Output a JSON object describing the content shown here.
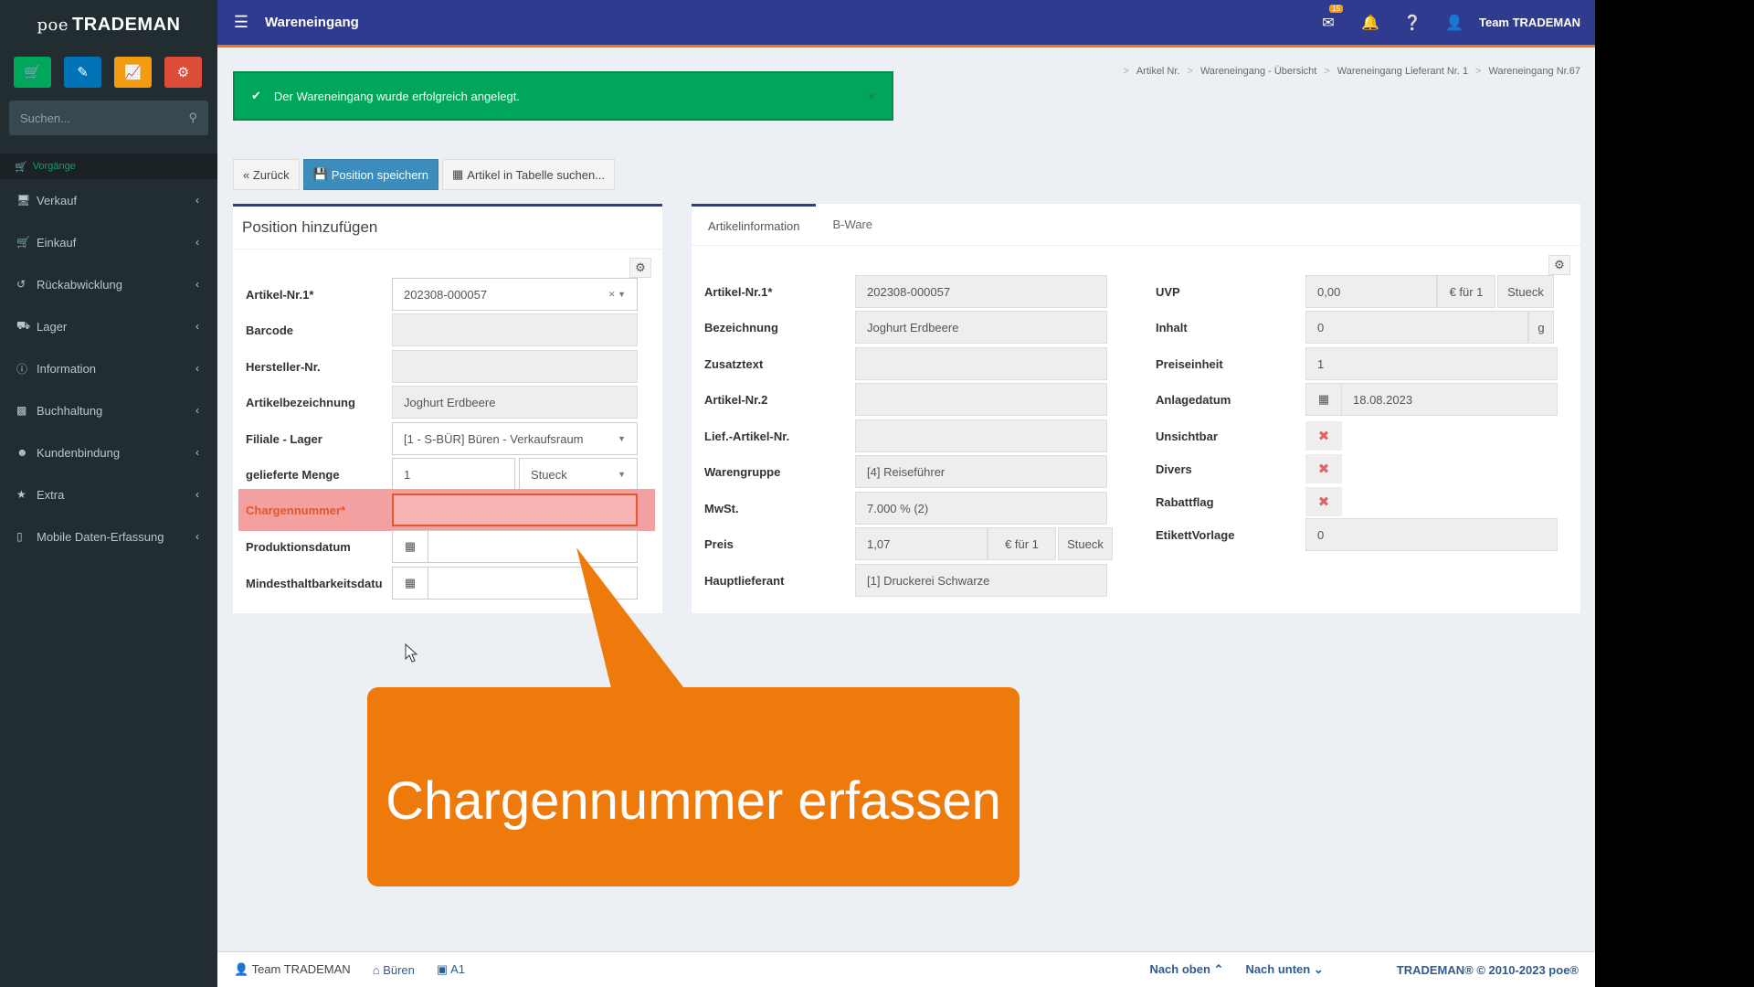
{
  "brand": {
    "poe": "poe",
    "name": "TRADEMAN"
  },
  "header": {
    "title": "Wareneingang",
    "user": "Team TRADEMAN",
    "mail_badge": "15"
  },
  "sidebar": {
    "search_placeholder": "Suchen...",
    "section": "Vorgänge",
    "items": [
      {
        "label": "Verkauf",
        "icon": "monitor-icon"
      },
      {
        "label": "Einkauf",
        "icon": "cart-icon"
      },
      {
        "label": "Rückabwicklung",
        "icon": "undo-icon"
      },
      {
        "label": "Lager",
        "icon": "truck-icon"
      },
      {
        "label": "Information",
        "icon": "info-icon"
      },
      {
        "label": "Buchhaltung",
        "icon": "money-icon"
      },
      {
        "label": "Kundenbindung",
        "icon": "users-icon"
      },
      {
        "label": "Extra",
        "icon": "star-icon"
      },
      {
        "label": "Mobile Daten-Erfassung",
        "icon": "mobile-icon"
      }
    ],
    "quick_colors": [
      "#00a65a",
      "#0073b7",
      "#f39c12",
      "#dd4b39"
    ]
  },
  "alert": {
    "text": "Der Wareneingang wurde erfolgreich angelegt."
  },
  "breadcrumb": [
    "Artikel Nr.",
    "Wareneingang - Übersicht",
    "Wareneingang Lieferant Nr. 1",
    "Wareneingang Nr.67"
  ],
  "toolbar": {
    "back": "« Zurück",
    "save": "Position speichern",
    "search": "Artikel in Tabelle suchen..."
  },
  "left_form": {
    "title": "Position hinzufügen",
    "artikel_nr_label": "Artikel-Nr.1*",
    "artikel_nr": "202308-000057",
    "barcode_label": "Barcode",
    "hersteller_label": "Hersteller-Nr.",
    "bezeichnung_label": "Artikelbezeichnung",
    "bezeichnung": "Joghurt Erdbeere",
    "filiale_label": "Filiale - Lager",
    "filiale": "[1 - S-BÜR] Büren - Verkaufsraum",
    "menge_label": "gelieferte Menge",
    "menge": "1",
    "einheit": "Stueck",
    "charge_label": "Chargennummer*",
    "prod_label": "Produktionsdatum",
    "mhd_label": "Mindesthaltbarkeitsdatu"
  },
  "right_panel": {
    "tabs": [
      "Artikelinformation",
      "B-Ware"
    ],
    "artikel_nr_label": "Artikel-Nr.1*",
    "artikel_nr": "202308-000057",
    "bezeichnung_label": "Bezeichnung",
    "bezeichnung": "Joghurt Erdbeere",
    "zusatz_label": "Zusatztext",
    "nr2_label": "Artikel-Nr.2",
    "lief_label": "Lief.-Artikel-Nr.",
    "warengruppe_label": "Warengruppe",
    "warengruppe": "[4] Reiseführer",
    "mwst_label": "MwSt.",
    "mwst": "7.000 % (2)",
    "preis_label": "Preis",
    "preis": "1,07",
    "preis_per": "€ für 1",
    "preis_unit": "Stueck",
    "hauptlief_label": "Hauptlieferant",
    "hauptlief": "[1] Druckerei Schwarze",
    "uvp_label": "UVP",
    "uvp": "0,00",
    "uvp_per": "€ für 1",
    "uvp_unit": "Stueck",
    "inhalt_label": "Inhalt",
    "inhalt": "0",
    "inhalt_unit": "g",
    "preiseinheit_label": "Preiseinheit",
    "preiseinheit": "1",
    "anlage_label": "Anlagedatum",
    "anlage": "18.08.2023",
    "unsichtbar_label": "Unsichtbar",
    "divers_label": "Divers",
    "rabatt_label": "Rabattflag",
    "etikett_label": "EtikettVorlage",
    "etikett": "0"
  },
  "callout": {
    "text": "Chargennummer erfassen",
    "color": "#ef7a0c"
  },
  "footer": {
    "user": "Team TRADEMAN",
    "location": "Büren",
    "station": "A1",
    "up": "Nach oben",
    "down": "Nach unten",
    "copyright": "TRADEMAN® © 2010-2023 poe®"
  }
}
